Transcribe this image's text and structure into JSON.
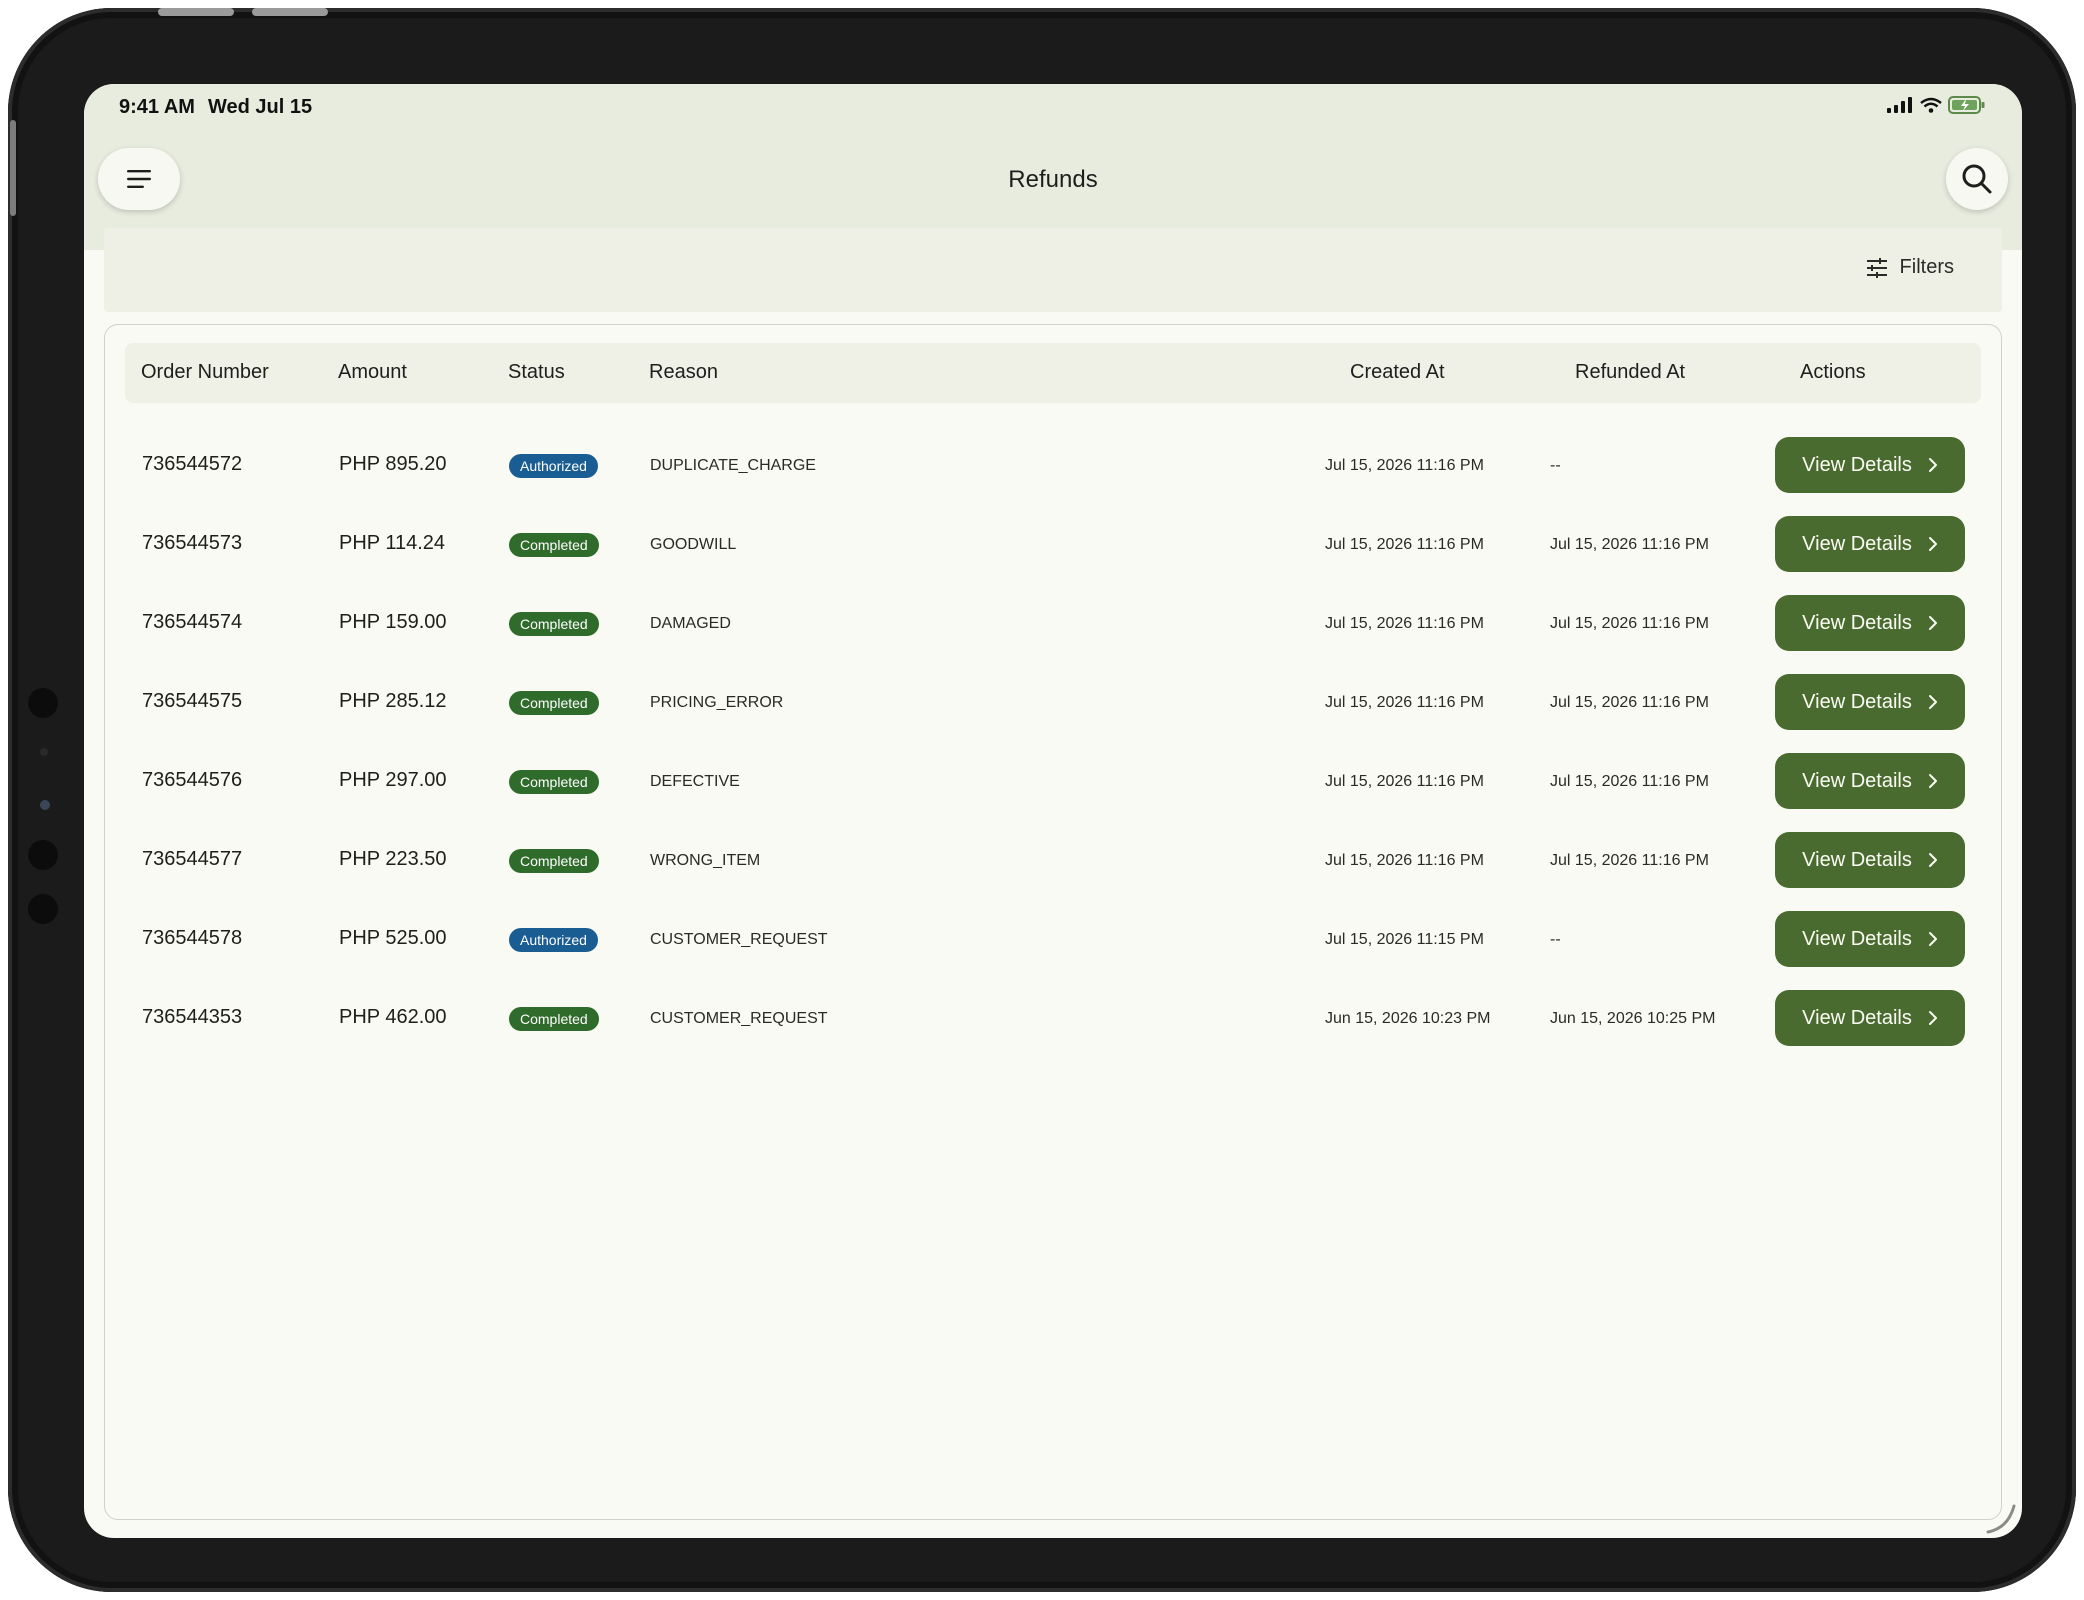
{
  "status_bar": {
    "time": "9:41 AM",
    "date": "Wed Jul 15"
  },
  "header": {
    "title": "Refunds",
    "menu_icon": "hamburger-menu-icon",
    "search_icon": "search-icon"
  },
  "filters": {
    "label": "Filters",
    "icon": "sliders-icon"
  },
  "table": {
    "columns": [
      "Order Number",
      "Amount",
      "Status",
      "Reason",
      "Created At",
      "Refunded At",
      "Actions"
    ],
    "action_label": "View Details",
    "status_colors": {
      "Authorized": "#1a5d93",
      "Completed": "#2f6b2a"
    },
    "rows": [
      {
        "order": "736544572",
        "amount": "PHP 895.20",
        "status": "Authorized",
        "reason": "DUPLICATE_CHARGE",
        "created": "Jul 15, 2026 11:16 PM",
        "refunded": "--"
      },
      {
        "order": "736544573",
        "amount": "PHP 114.24",
        "status": "Completed",
        "reason": "GOODWILL",
        "created": "Jul 15, 2026 11:16 PM",
        "refunded": "Jul 15, 2026 11:16 PM"
      },
      {
        "order": "736544574",
        "amount": "PHP 159.00",
        "status": "Completed",
        "reason": "DAMAGED",
        "created": "Jul 15, 2026 11:16 PM",
        "refunded": "Jul 15, 2026 11:16 PM"
      },
      {
        "order": "736544575",
        "amount": "PHP 285.12",
        "status": "Completed",
        "reason": "PRICING_ERROR",
        "created": "Jul 15, 2026 11:16 PM",
        "refunded": "Jul 15, 2026 11:16 PM"
      },
      {
        "order": "736544576",
        "amount": "PHP 297.00",
        "status": "Completed",
        "reason": "DEFECTIVE",
        "created": "Jul 15, 2026 11:16 PM",
        "refunded": "Jul 15, 2026 11:16 PM"
      },
      {
        "order": "736544577",
        "amount": "PHP 223.50",
        "status": "Completed",
        "reason": "WRONG_ITEM",
        "created": "Jul 15, 2026 11:16 PM",
        "refunded": "Jul 15, 2026 11:16 PM"
      },
      {
        "order": "736544578",
        "amount": "PHP 525.00",
        "status": "Authorized",
        "reason": "CUSTOMER_REQUEST",
        "created": "Jul 15, 2026 11:15 PM",
        "refunded": "--"
      },
      {
        "order": "736544353",
        "amount": "PHP 462.00",
        "status": "Completed",
        "reason": "CUSTOMER_REQUEST",
        "created": "Jun 15, 2026 10:23 PM",
        "refunded": "Jun 15, 2026 10:25 PM"
      }
    ]
  },
  "colors": {
    "accent": "#4a6b2f",
    "header_bg": "#e8ecdf",
    "page_bg": "#fafaf4"
  }
}
